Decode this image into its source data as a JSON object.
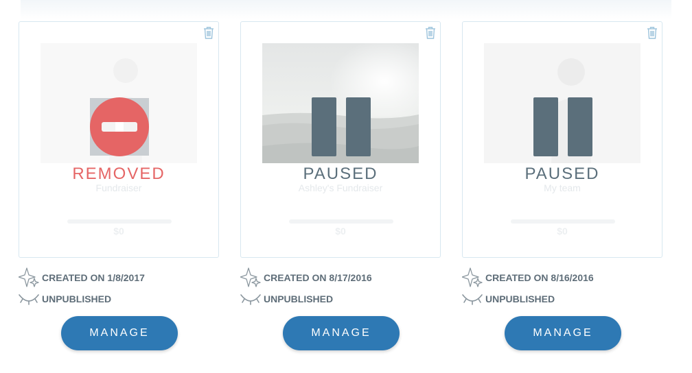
{
  "cards": [
    {
      "status": "REMOVED",
      "name": "Fundraiser",
      "amount": "$0",
      "created": "CREATED ON 1/8/2017",
      "visibility": "UNPUBLISHED",
      "manage_label": "MANAGE"
    },
    {
      "status": "PAUSED",
      "name": "Ashley's Fundraiser",
      "amount": "$0",
      "created": "CREATED ON 8/17/2016",
      "visibility": "UNPUBLISHED",
      "manage_label": "MANAGE"
    },
    {
      "status": "PAUSED",
      "name": "My team",
      "amount": "$0",
      "created": "CREATED ON 8/16/2016",
      "visibility": "UNPUBLISHED",
      "manage_label": "MANAGE"
    }
  ],
  "icons": {
    "delete": "trash-icon",
    "removed": "removed-icon",
    "paused": "pause-icon",
    "created": "sparkle-icon",
    "unpublished": "closed-eye-icon"
  },
  "colors": {
    "accent": "#2e79b4",
    "removed": "#e56565",
    "paused": "#5b6f7b",
    "card_border": "#d7e7f0",
    "meta_text": "#5e6d78"
  }
}
